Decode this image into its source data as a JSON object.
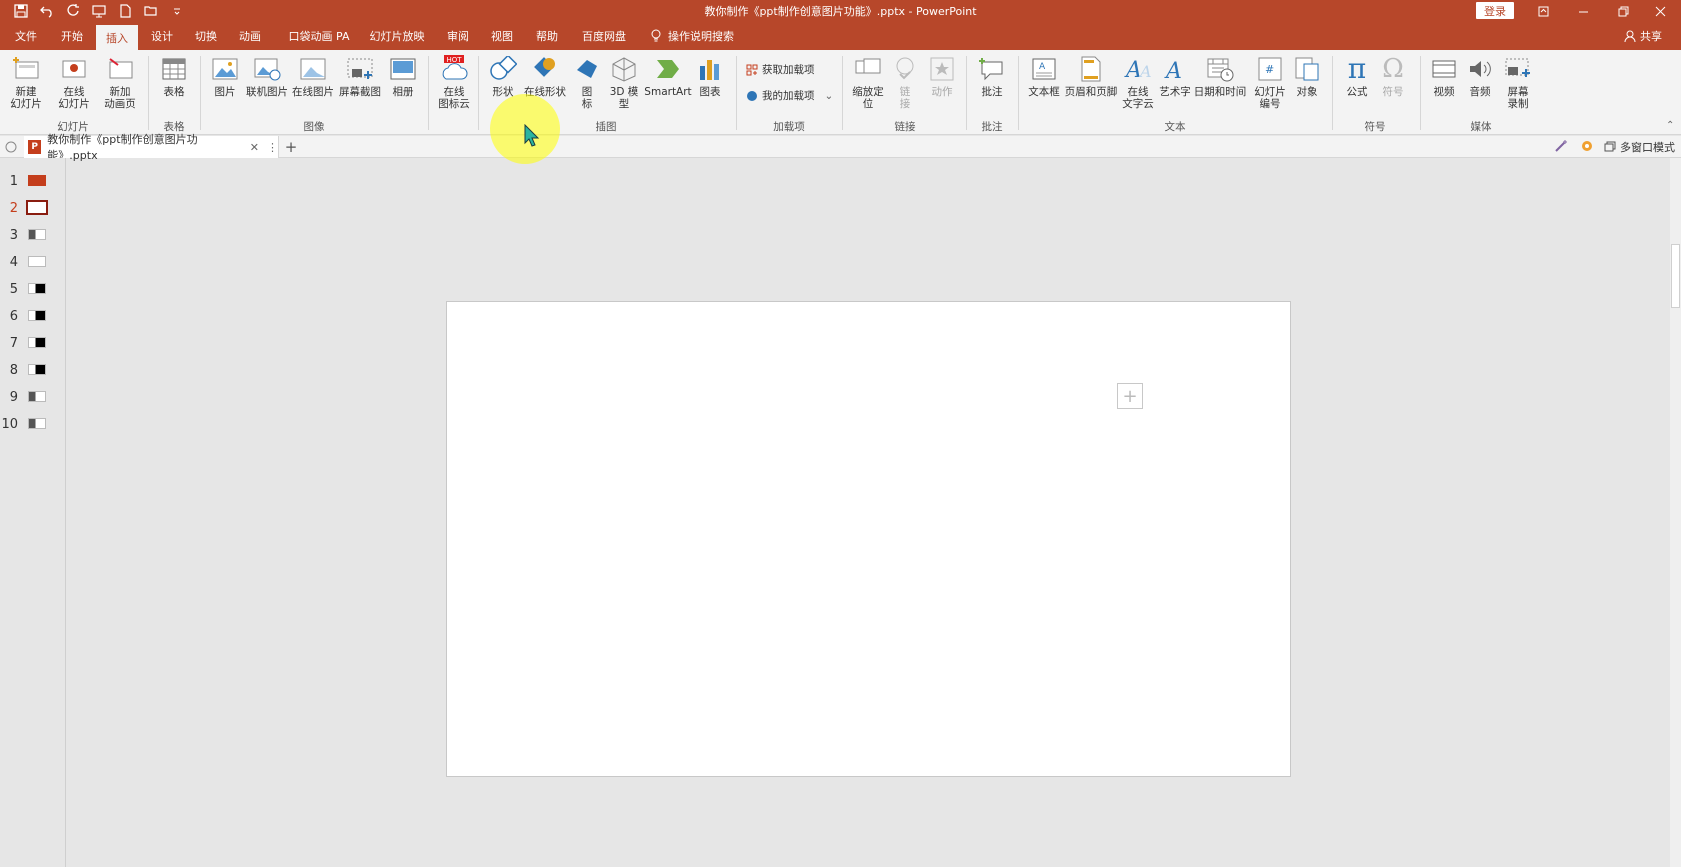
{
  "app": {
    "window_title": "教你制作《ppt制作创意图片功能》.pptx - PowerPoint",
    "login_label": "登录",
    "share_label": "共享",
    "accent_color": "#b7472a"
  },
  "tabs": [
    {
      "label": "文件"
    },
    {
      "label": "开始"
    },
    {
      "label": "插入"
    },
    {
      "label": "设计"
    },
    {
      "label": "切换"
    },
    {
      "label": "动画"
    },
    {
      "label": "口袋动画 PA"
    },
    {
      "label": "幻灯片放映"
    },
    {
      "label": "审阅"
    },
    {
      "label": "视图"
    },
    {
      "label": "帮助"
    },
    {
      "label": "百度网盘"
    }
  ],
  "tell_me": "操作说明搜索",
  "ribbon": {
    "slides": {
      "new_slide_1": "新建",
      "new_slide_2": "幻灯片",
      "online_slide_1": "在线",
      "online_slide_2": "幻灯片",
      "new_anim_1": "新加",
      "new_anim_2": "动画页",
      "group": "幻灯片"
    },
    "table": {
      "table": "表格",
      "group": "表格"
    },
    "images": {
      "picture": "图片",
      "online_picture": "联机图片",
      "online_image": "在线图片",
      "screenshot": "屏幕截图",
      "album": "相册",
      "group": "图像"
    },
    "iconcloud": {
      "label_1": "在线",
      "label_2": "图标云",
      "badge": "HOT"
    },
    "illustrations": {
      "shapes": "形状",
      "online_shapes": "在线形状",
      "icons_1": "图",
      "icons_2": "标",
      "model3d_1": "3D 模",
      "model3d_2": "型",
      "smartart": "SmartArt",
      "chart": "图表",
      "group": "插图"
    },
    "addins": {
      "get": "获取加载项",
      "mine": "我的加载项",
      "group": "加载项"
    },
    "links": {
      "zoom_1": "缩放定",
      "zoom_2": "位",
      "link_1": "链",
      "link_2": "接",
      "action": "动作",
      "group": "链接"
    },
    "comments": {
      "comment": "批注",
      "group": "批注"
    },
    "text": {
      "textbox": "文本框",
      "header_footer": "页眉和页脚",
      "online_text_1": "在线",
      "online_text_2": "文字云",
      "wordart": "艺术字",
      "datetime": "日期和时间",
      "slide_num_1": "幻灯片",
      "slide_num_2": "编号",
      "object": "对象",
      "group": "文本"
    },
    "symbols": {
      "equation": "公式",
      "symbol": "符号",
      "group": "符号"
    },
    "media": {
      "video": "视频",
      "audio": "音频",
      "screen_rec_1": "屏幕",
      "screen_rec_2": "录制",
      "group": "媒体"
    }
  },
  "doc_tab": {
    "name": "教你制作《ppt制作创意图片功能》.pptx",
    "multi_window": "多窗口模式"
  },
  "thumbnails": [
    {
      "num": "1"
    },
    {
      "num": "2"
    },
    {
      "num": "3"
    },
    {
      "num": "4"
    },
    {
      "num": "5"
    },
    {
      "num": "6"
    },
    {
      "num": "7"
    },
    {
      "num": "8"
    },
    {
      "num": "9"
    },
    {
      "num": "10"
    }
  ]
}
